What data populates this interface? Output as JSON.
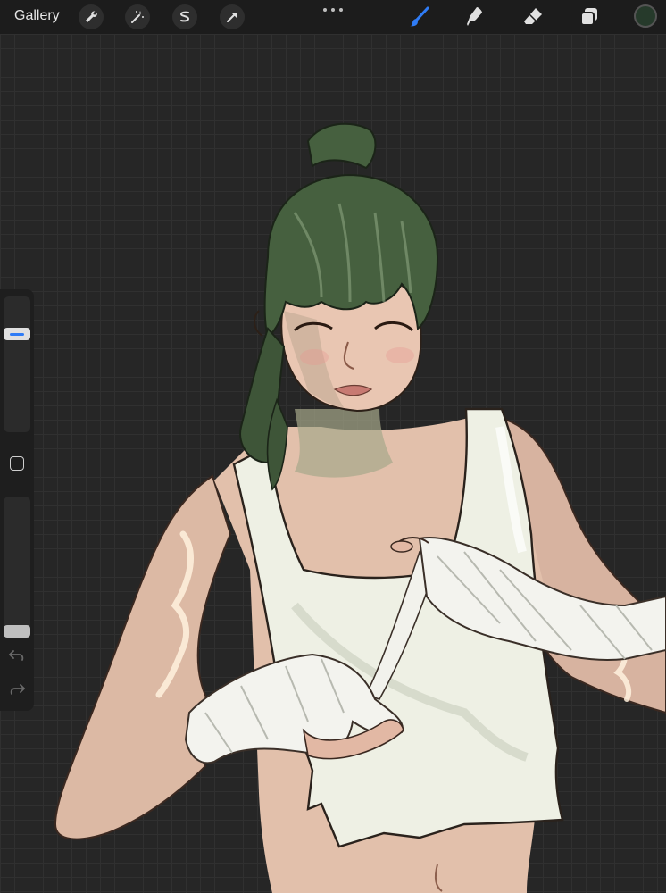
{
  "toolbar": {
    "gallery_label": "Gallery",
    "left_tools": [
      "wrench-icon",
      "magic-wand-icon",
      "selection-icon",
      "transform-arrow-icon"
    ],
    "right_tools": [
      "brush-icon",
      "smudge-icon",
      "eraser-icon",
      "layers-icon"
    ],
    "active_tool": "brush-icon",
    "active_color": "#263a2b",
    "accent_color": "#2f7cf6"
  },
  "sidebar": {
    "brush_size_level": 0.75,
    "opacity_level": 1.0
  },
  "canvas": {
    "background": "#262626",
    "grid_color": "#303030"
  }
}
